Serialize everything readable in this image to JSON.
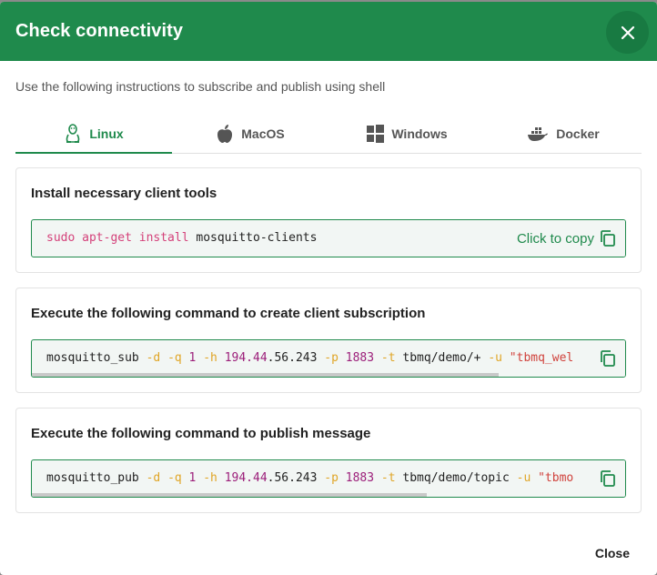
{
  "dialog": {
    "title": "Check connectivity",
    "subtitle": "Use the following instructions to subscribe and publish using shell",
    "close_label": "Close"
  },
  "tabs": [
    {
      "label": "Linux",
      "icon": "linux-penguin-icon",
      "active": true
    },
    {
      "label": "MacOS",
      "icon": "apple-icon",
      "active": false
    },
    {
      "label": "Windows",
      "icon": "windows-icon",
      "active": false
    },
    {
      "label": "Docker",
      "icon": "docker-icon",
      "active": false
    }
  ],
  "steps": [
    {
      "title": "Install necessary client tools",
      "command": {
        "p1": "sudo apt-get install",
        "p2": " mosquitto-clients"
      },
      "copy_label": "Click to copy"
    },
    {
      "title": "Execute the following command to create client subscription",
      "command": {
        "cmd": "mosquitto_sub",
        "f1": "-d",
        "f2": "-q",
        "n1": "1",
        "f3": "-h",
        "host_a": "194.44",
        "host_b": ".56.243",
        "f4": "-p",
        "port": "1883",
        "f5": "-t",
        "topic": "tbmq/demo/+",
        "f6": "-u",
        "user": "\"tbmq_wel"
      }
    },
    {
      "title": "Execute the following command to publish message",
      "command": {
        "cmd": "mosquitto_pub",
        "f1": "-d",
        "f2": "-q",
        "n1": "1",
        "f3": "-h",
        "host_a": "194.44",
        "host_b": ".56.243",
        "f4": "-p",
        "port": "1883",
        "f5": "-t",
        "topic": "tbmq/demo/topic",
        "f6": "-u",
        "user": "\"tbmo"
      }
    }
  ],
  "colors": {
    "accent": "#1f8a4c",
    "keyword": "#d4417a",
    "flag": "#e0a526",
    "number": "#9c1f7a",
    "string": "#d0423c"
  }
}
